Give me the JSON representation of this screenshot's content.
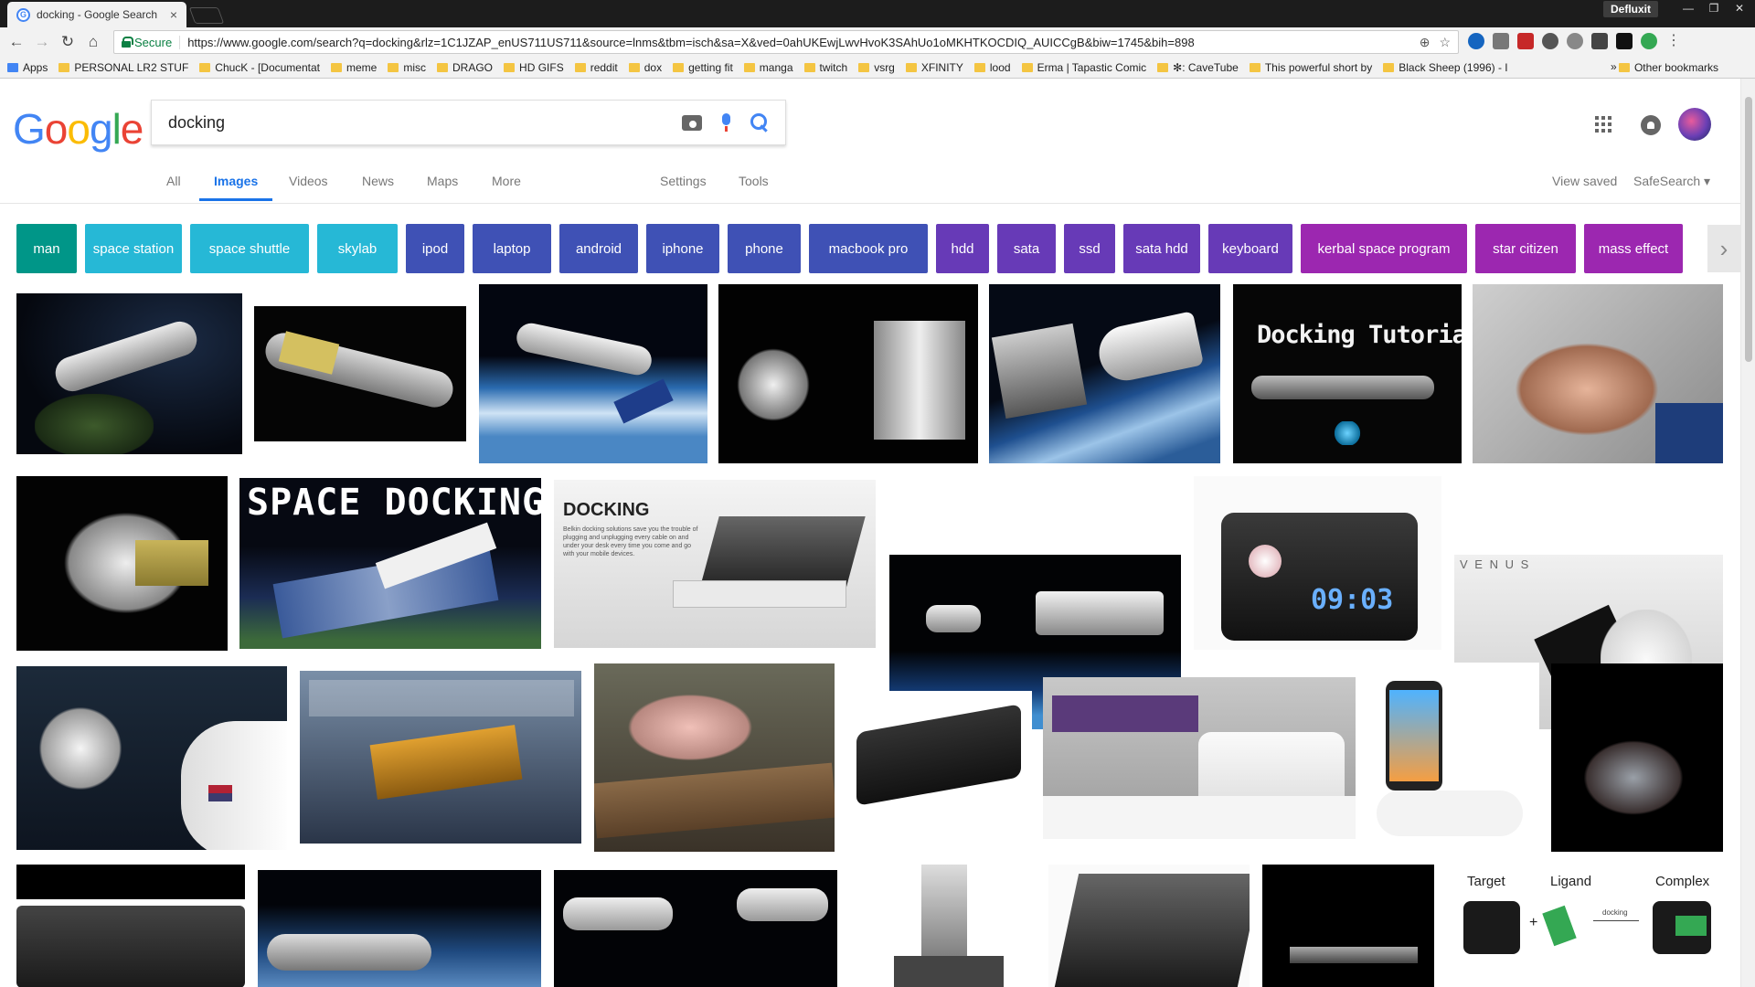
{
  "browser": {
    "tab_title": "docking - Google Search",
    "tab_close": "×",
    "profile": "Defluxit",
    "window_controls": [
      "—",
      "❐",
      "✕"
    ],
    "secure_label": "Secure",
    "url": "https://www.google.com/search?q=docking&rlz=1C1JZAP_enUS711US711&source=lnms&tbm=isch&sa=X&ved=0ahUKEwjLwvHvoK3SAhUo1oMKHTKOCDIQ_AUICCgB&biw=1745&bih=898",
    "bookmarks": [
      "Apps",
      "PERSONAL LR2 STUF",
      "ChucK - [Documentat",
      "meme",
      "misc",
      "DRAGO",
      "HD GIFS",
      "reddit",
      "dox",
      "getting fit",
      "manga",
      "twitch",
      "vsrg",
      "XFINITY",
      "lood",
      "Erma | Tapastic Comic",
      "✻: CaveTube",
      "This powerful short by",
      "Black Sheep (1996) - I"
    ],
    "bookmarks_more": "»",
    "other_bookmarks": "Other bookmarks"
  },
  "search": {
    "logo": [
      "G",
      "o",
      "o",
      "g",
      "l",
      "e"
    ],
    "logo_colors": [
      "#4285f4",
      "#ea4335",
      "#fbbc05",
      "#4285f4",
      "#34a853",
      "#ea4335"
    ],
    "query": "docking"
  },
  "tabs": {
    "all": "All",
    "images": "Images",
    "videos": "Videos",
    "news": "News",
    "maps": "Maps",
    "more": "More",
    "settings": "Settings",
    "tools": "Tools",
    "view_saved": "View saved",
    "safesearch": "SafeSearch ▾"
  },
  "chips": [
    {
      "label": "man",
      "color": "#009688"
    },
    {
      "label": "space station",
      "color": "#26b8d6"
    },
    {
      "label": "space shuttle",
      "color": "#26b8d6"
    },
    {
      "label": "skylab",
      "color": "#26b8d6"
    },
    {
      "label": "ipod",
      "color": "#3f51b5"
    },
    {
      "label": "laptop",
      "color": "#3f51b5"
    },
    {
      "label": "android",
      "color": "#3f51b5"
    },
    {
      "label": "iphone",
      "color": "#3f51b5"
    },
    {
      "label": "phone",
      "color": "#3f51b5"
    },
    {
      "label": "macbook pro",
      "color": "#3f51b5"
    },
    {
      "label": "hdd",
      "color": "#673ab7"
    },
    {
      "label": "sata",
      "color": "#673ab7"
    },
    {
      "label": "ssd",
      "color": "#673ab7"
    },
    {
      "label": "sata hdd",
      "color": "#673ab7"
    },
    {
      "label": "keyboard",
      "color": "#673ab7"
    },
    {
      "label": "kerbal space program",
      "color": "#9c27b0"
    },
    {
      "label": "star citizen",
      "color": "#9c27b0"
    },
    {
      "label": "mass effect",
      "color": "#9c27b0"
    }
  ],
  "chip_more": "›",
  "image_texts": {
    "docking_tutorial": "Docking Tutorial",
    "space_docking": "SPACE DOCKING",
    "docking_ad_title": "DOCKING",
    "docking_ad_body": "Belkin docking solutions save you the trouble of plugging and unplugging every cable on and under your desk every time you come and go with your mobile devices.",
    "clock": "09:03",
    "venus": "V E N U S",
    "target": "Target",
    "ligand": "Ligand",
    "complex": "Complex",
    "docking_arrow": "docking",
    "plus": "+"
  }
}
